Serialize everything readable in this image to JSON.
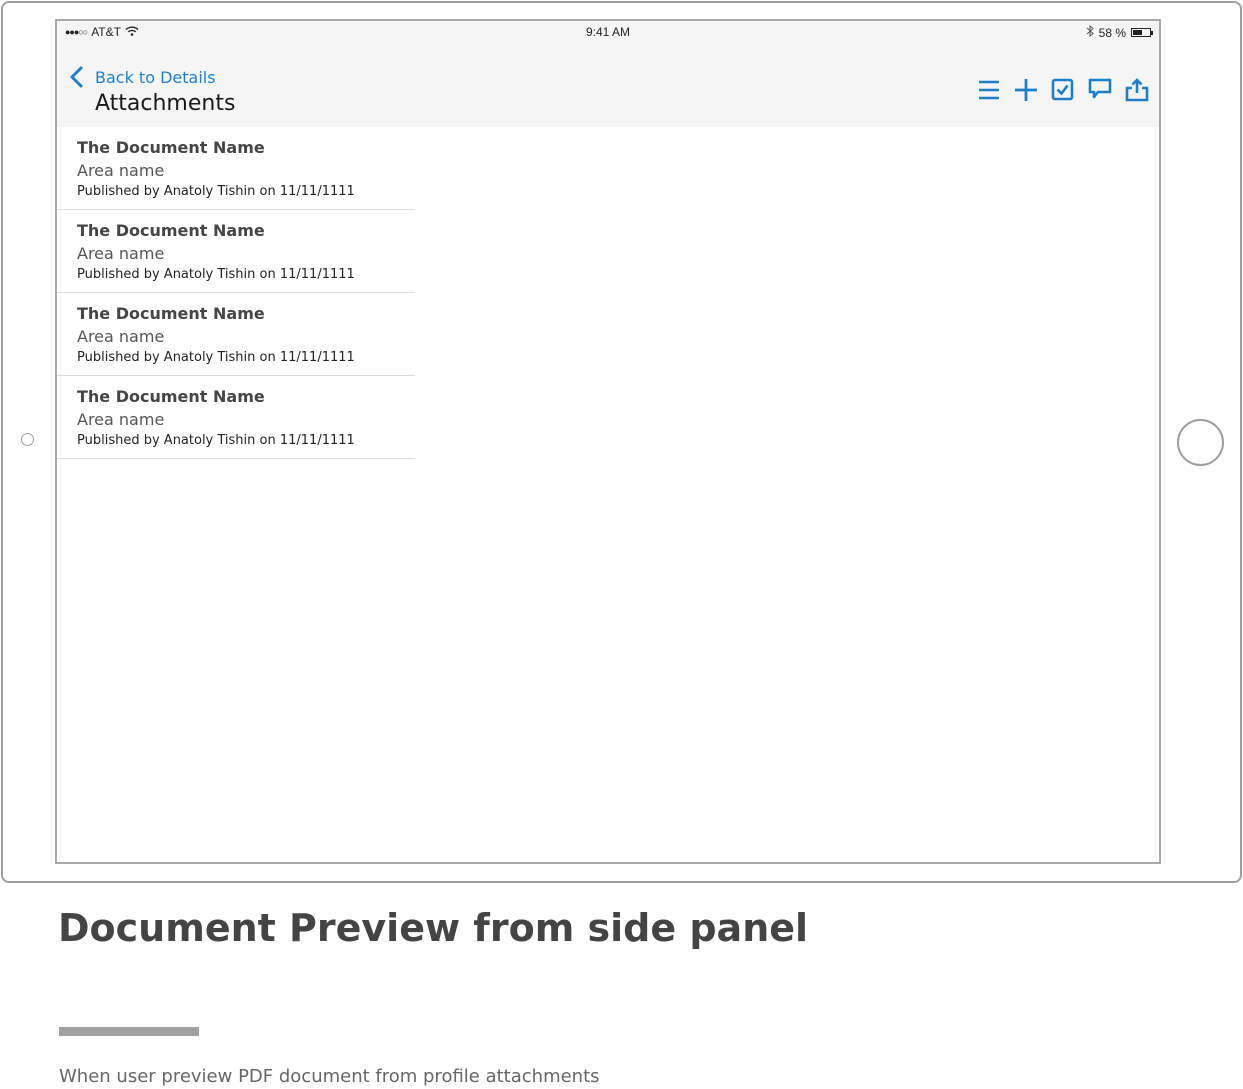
{
  "status_bar": {
    "signal": "●●●○○",
    "carrier": "AT&T",
    "time": "9:41 AM",
    "battery_percent": "58 %",
    "battery_level": 0.58
  },
  "nav": {
    "back_label": "Back to Details",
    "title": "Attachments"
  },
  "toolbar": {
    "icons": [
      "menu-icon",
      "add-icon",
      "checkbox-icon",
      "comment-icon",
      "share-icon"
    ]
  },
  "attachments": [
    {
      "name": "The Document Name",
      "area": "Area name",
      "published": "Published by Anatoly Tishin on 11/11/1111"
    },
    {
      "name": "The Document Name",
      "area": "Area name",
      "published": "Published by Anatoly Tishin on 11/11/1111"
    },
    {
      "name": "The Document Name",
      "area": "Area name",
      "published": "Published by Anatoly Tishin on 11/11/1111"
    },
    {
      "name": "The Document Name",
      "area": "Area name",
      "published": "Published by Anatoly Tishin on 11/11/1111"
    }
  ],
  "page": {
    "heading": "Document Preview from side panel",
    "caption": "When user preview PDF document from profile attachments"
  },
  "colors": {
    "accent": "#1f7fc6",
    "topbar_bg": "#f5f5f5",
    "device_border": "#9e9e9e"
  }
}
